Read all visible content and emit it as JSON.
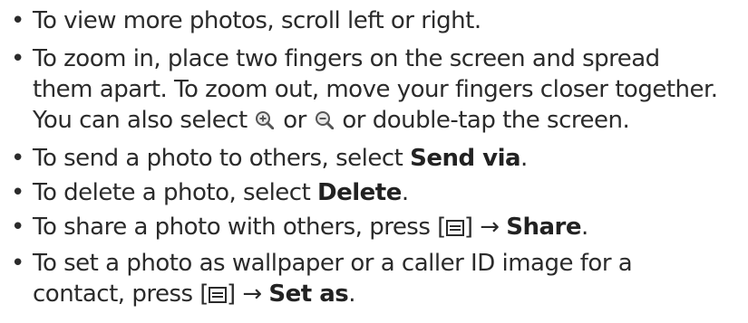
{
  "bullets": [
    {
      "text": "To view more photos, scroll left or right."
    },
    {
      "line1": "To zoom in, place two fingers on the screen and spread",
      "line2": "them apart. To zoom out, move your fingers closer together.",
      "line3_a": "You can also select ",
      "line3_b": " or ",
      "line3_c": " or double-tap the screen."
    },
    {
      "a": "To send a photo to others, select ",
      "bold": "Send via",
      "end": "."
    },
    {
      "a": "To delete a photo, select ",
      "bold": "Delete",
      "end": "."
    },
    {
      "a": "To share a photo with others, press [",
      "b": "] → ",
      "bold": "Share",
      "end": "."
    },
    {
      "line1": "To set a photo as wallpaper or a caller ID image for a",
      "a": "contact, press [",
      "b": "] → ",
      "bold": "Set as",
      "end": "."
    }
  ],
  "bullet_char": "•",
  "icons": [
    "zoom-in-icon",
    "zoom-out-icon",
    "menu-key-icon"
  ]
}
